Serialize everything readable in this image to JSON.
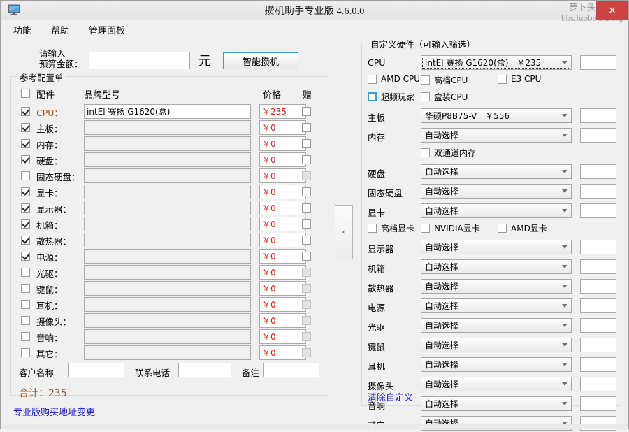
{
  "window": {
    "title": "攒机助手专业版 4.6.0.0",
    "icon": "monitor-icon",
    "close_label": "×",
    "watermark_line1": "萝卜头IT论坛",
    "watermark_line2": "bbs.luobotou.org"
  },
  "menu": {
    "items": [
      {
        "label": "功能"
      },
      {
        "label": "帮助"
      },
      {
        "label": "管理面板"
      }
    ]
  },
  "budget": {
    "label_line1": "请输入",
    "label_line2": "预算金额：",
    "value": "",
    "placeholder": "",
    "unit": "元",
    "button_label": "智能攒机"
  },
  "left_panel": {
    "group_title": "参考配置单",
    "headers": {
      "part": "配件",
      "model": "品牌型号",
      "price": "价格",
      "gift": "赠"
    },
    "header_checked": false,
    "rows": [
      {
        "label": "CPU：",
        "checked": true,
        "model": "intEl 赛扬 G1620(盒)",
        "price": "￥235",
        "gift_checked": false,
        "gift_disabled": false,
        "accent": true
      },
      {
        "label": "主板：",
        "checked": true,
        "model": "",
        "price": "￥0",
        "gift_checked": false,
        "gift_disabled": false,
        "accent": false
      },
      {
        "label": "内存：",
        "checked": true,
        "model": "",
        "price": "￥0",
        "gift_checked": false,
        "gift_disabled": false,
        "accent": false
      },
      {
        "label": "硬盘：",
        "checked": true,
        "model": "",
        "price": "￥0",
        "gift_checked": false,
        "gift_disabled": false,
        "accent": false
      },
      {
        "label": "固态硬盘：",
        "checked": false,
        "model": "",
        "price": "￥0",
        "gift_checked": false,
        "gift_disabled": true,
        "accent": false
      },
      {
        "label": "显卡：",
        "checked": true,
        "model": "",
        "price": "￥0",
        "gift_checked": false,
        "gift_disabled": false,
        "accent": false
      },
      {
        "label": "显示器：",
        "checked": true,
        "model": "",
        "price": "￥0",
        "gift_checked": false,
        "gift_disabled": false,
        "accent": false
      },
      {
        "label": "机箱：",
        "checked": true,
        "model": "",
        "price": "￥0",
        "gift_checked": false,
        "gift_disabled": false,
        "accent": false
      },
      {
        "label": "散热器：",
        "checked": true,
        "model": "",
        "price": "￥0",
        "gift_checked": false,
        "gift_disabled": false,
        "accent": false
      },
      {
        "label": "电源：",
        "checked": true,
        "model": "",
        "price": "￥0",
        "gift_checked": false,
        "gift_disabled": false,
        "accent": false
      },
      {
        "label": "光驱：",
        "checked": false,
        "model": "",
        "price": "￥0",
        "gift_checked": false,
        "gift_disabled": true,
        "accent": false
      },
      {
        "label": "键鼠：",
        "checked": false,
        "model": "",
        "price": "￥0",
        "gift_checked": false,
        "gift_disabled": true,
        "accent": false
      },
      {
        "label": "耳机：",
        "checked": false,
        "model": "",
        "price": "￥0",
        "gift_checked": false,
        "gift_disabled": true,
        "accent": false
      },
      {
        "label": "摄像头：",
        "checked": false,
        "model": "",
        "price": "￥0",
        "gift_checked": false,
        "gift_disabled": true,
        "accent": false
      },
      {
        "label": "音响：",
        "checked": false,
        "model": "",
        "price": "￥0",
        "gift_checked": false,
        "gift_disabled": true,
        "accent": false
      },
      {
        "label": "其它：",
        "checked": false,
        "model": "",
        "price": "￥0",
        "gift_checked": false,
        "gift_disabled": true,
        "accent": false
      }
    ],
    "customer": {
      "name_label": "客户名称",
      "name_value": "",
      "phone_label": "联系电话",
      "phone_value": "",
      "note_label": "备注",
      "note_value": ""
    },
    "total_label": "合计：235"
  },
  "collapse_handle": {
    "glyph": "‹"
  },
  "right_panel": {
    "group_title": "自定义硬件（可输入筛选）",
    "rows": [
      {
        "label": "CPU",
        "value": "intEl 赛扬 G1620(盒)　￥235",
        "qty": "",
        "focus": true
      },
      {
        "label": "主板",
        "value": "华硕P8B75-V　￥556",
        "qty": "",
        "focus": false
      },
      {
        "label": "内存",
        "value": "自动选择",
        "qty": "",
        "focus": false
      },
      {
        "label": "硬盘",
        "value": "自动选择",
        "qty": "",
        "focus": false
      },
      {
        "label": "固态硬盘",
        "value": "自动选择",
        "qty": "",
        "focus": false
      },
      {
        "label": "显卡",
        "value": "自动选择",
        "qty": "",
        "focus": false
      },
      {
        "label": "显示器",
        "value": "自动选择",
        "qty": "",
        "focus": false
      },
      {
        "label": "机箱",
        "value": "自动选择",
        "qty": "",
        "focus": false
      },
      {
        "label": "散热器",
        "value": "自动选择",
        "qty": "",
        "focus": false
      },
      {
        "label": "电源",
        "value": "自动选择",
        "qty": "",
        "focus": false
      },
      {
        "label": "光驱",
        "value": "自动选择",
        "qty": "",
        "focus": false
      },
      {
        "label": "键鼠",
        "value": "自动选择",
        "qty": "",
        "focus": false
      },
      {
        "label": "耳机",
        "value": "自动选择",
        "qty": "",
        "focus": false
      },
      {
        "label": "摄像头",
        "value": "自动选择",
        "qty": "",
        "focus": false
      },
      {
        "label": "音响",
        "value": "自动选择",
        "qty": "",
        "focus": false
      },
      {
        "label": "其它",
        "value": "自动选择",
        "qty": "",
        "focus": false
      }
    ],
    "cpu_filters_row1": [
      {
        "label": "AMD CPU",
        "checked": false,
        "focus": false
      },
      {
        "label": "高档CPU",
        "checked": false,
        "focus": false
      },
      {
        "label": "E3 CPU",
        "checked": false,
        "focus": false
      }
    ],
    "cpu_filters_row2": [
      {
        "label": "超频玩家",
        "checked": false,
        "focus": true
      },
      {
        "label": "盒装CPU",
        "checked": false,
        "focus": false
      }
    ],
    "memory_filter": {
      "label": "双通道内存",
      "checked": false
    },
    "gpu_filters": [
      {
        "label": "高档显卡",
        "checked": false
      },
      {
        "label": "NVIDIA显卡",
        "checked": false
      },
      {
        "label": "AMD显卡",
        "checked": false
      }
    ],
    "clear_link": "清除自定义"
  },
  "footer": {
    "pro_link": "专业版购买地址变更"
  },
  "colors": {
    "accent_blue": "#3a9bdc",
    "price_red": "#e81b1b",
    "total_brown": "#8a5a22",
    "link_blue": "#1414c8",
    "close_red": "#cf4242",
    "cpu_label": "#a05a28"
  }
}
